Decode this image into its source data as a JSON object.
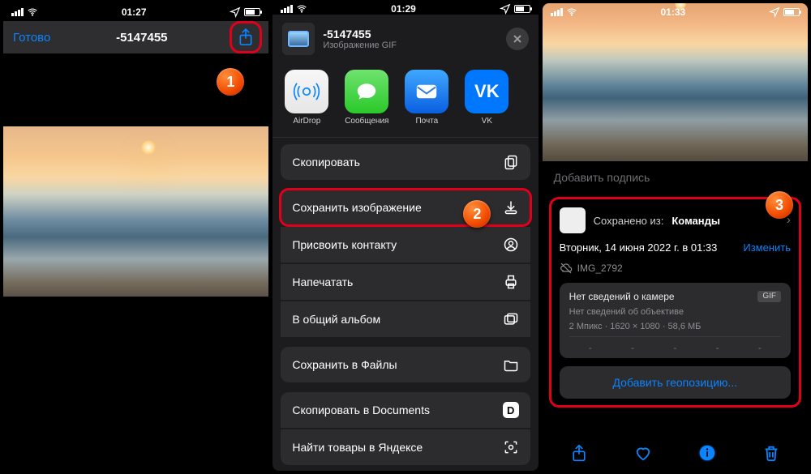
{
  "status": {
    "time1": "01:27",
    "time2": "01:29",
    "time3": "01:33"
  },
  "screen1": {
    "done_label": "Готово",
    "title": "-5147455"
  },
  "screen2": {
    "title": "-5147455",
    "subtitle": "Изображение GIF",
    "apps": [
      {
        "label": "AirDrop"
      },
      {
        "label": "Сообщения"
      },
      {
        "label": "Почта"
      },
      {
        "label": "VK"
      }
    ],
    "actions": {
      "copy": "Скопировать",
      "save_image": "Сохранить изображение",
      "assign_contact": "Присвоить контакту",
      "print": "Напечатать",
      "shared_album": "В общий альбом",
      "save_files": "Сохранить в Файлы",
      "copy_documents": "Скопировать в Documents",
      "yandex": "Найти товары в Яндексе"
    }
  },
  "screen3": {
    "caption_placeholder": "Добавить подпись",
    "saved_from_prefix": "Сохранено из:",
    "saved_from_app": "Команды",
    "date": "Вторник, 14 июня 2022 г. в 01:33",
    "edit_label": "Изменить",
    "filename": "IMG_2792",
    "camera_none": "Нет сведений о камере",
    "format_chip": "GIF",
    "lens_none": "Нет сведений об объективе",
    "specs": "2 Мпикс · 1620 × 1080 · 58,6 МБ",
    "dash": "-",
    "geo_label": "Добавить геопозицию..."
  },
  "badges": {
    "b1": "1",
    "b2": "2",
    "b3": "3"
  }
}
